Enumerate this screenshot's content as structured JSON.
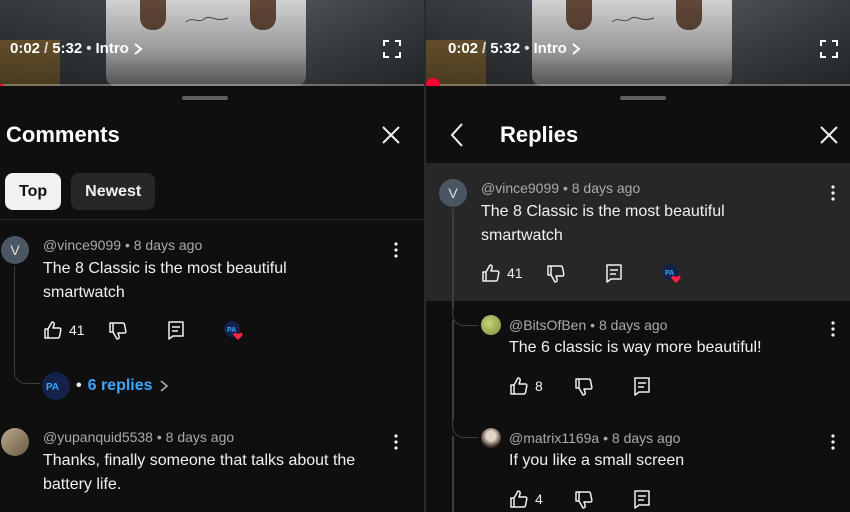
{
  "left": {
    "player": {
      "current_time": "0:02",
      "duration": "5:32",
      "chapter": "Intro",
      "progress_fraction": 0.006
    },
    "title": "Comments",
    "chips": [
      "Top",
      "Newest"
    ],
    "comments": [
      {
        "avatar_letter": "V",
        "author": "@vince9099",
        "age": "8 days ago",
        "text_lines": [
          "The 8 Classic is the most beautiful",
          "smartwatch"
        ],
        "likes": "41",
        "replies_label": "6 replies"
      },
      {
        "author": "@yupanquid5538",
        "age": "8 days ago",
        "text_lines": [
          "Thanks, finally someone that talks about the",
          "battery life."
        ]
      }
    ]
  },
  "right": {
    "player": {
      "current_time": "0:02",
      "duration": "5:32",
      "chapter": "Intro",
      "progress_fraction": 0.006
    },
    "title": "Replies",
    "parent": {
      "avatar_letter": "V",
      "author": "@vince9099",
      "age": "8 days ago",
      "text_lines": [
        "The 8 Classic is the most beautiful",
        "smartwatch"
      ],
      "likes": "41"
    },
    "replies": [
      {
        "author": "@BitsOfBen",
        "age": "8 days ago",
        "text": "The 6 classic is way more beautiful!",
        "likes": "8"
      },
      {
        "author": "@matrix1169a",
        "age": "8 days ago",
        "text": "If you like a small screen",
        "likes": "4"
      }
    ]
  },
  "separator": "•",
  "time_separator": "/",
  "colors": {
    "background": "#0f0f0f",
    "accent_red": "#ff0033",
    "link_blue": "#3ea6ff",
    "highlight": "#272727"
  },
  "icons": [
    "fullscreen-icon",
    "close-icon",
    "back-icon",
    "thumb-up-icon",
    "thumb-down-icon",
    "reply-icon",
    "kebab-menu-icon",
    "creator-heart-icon",
    "chevron-right-icon"
  ]
}
